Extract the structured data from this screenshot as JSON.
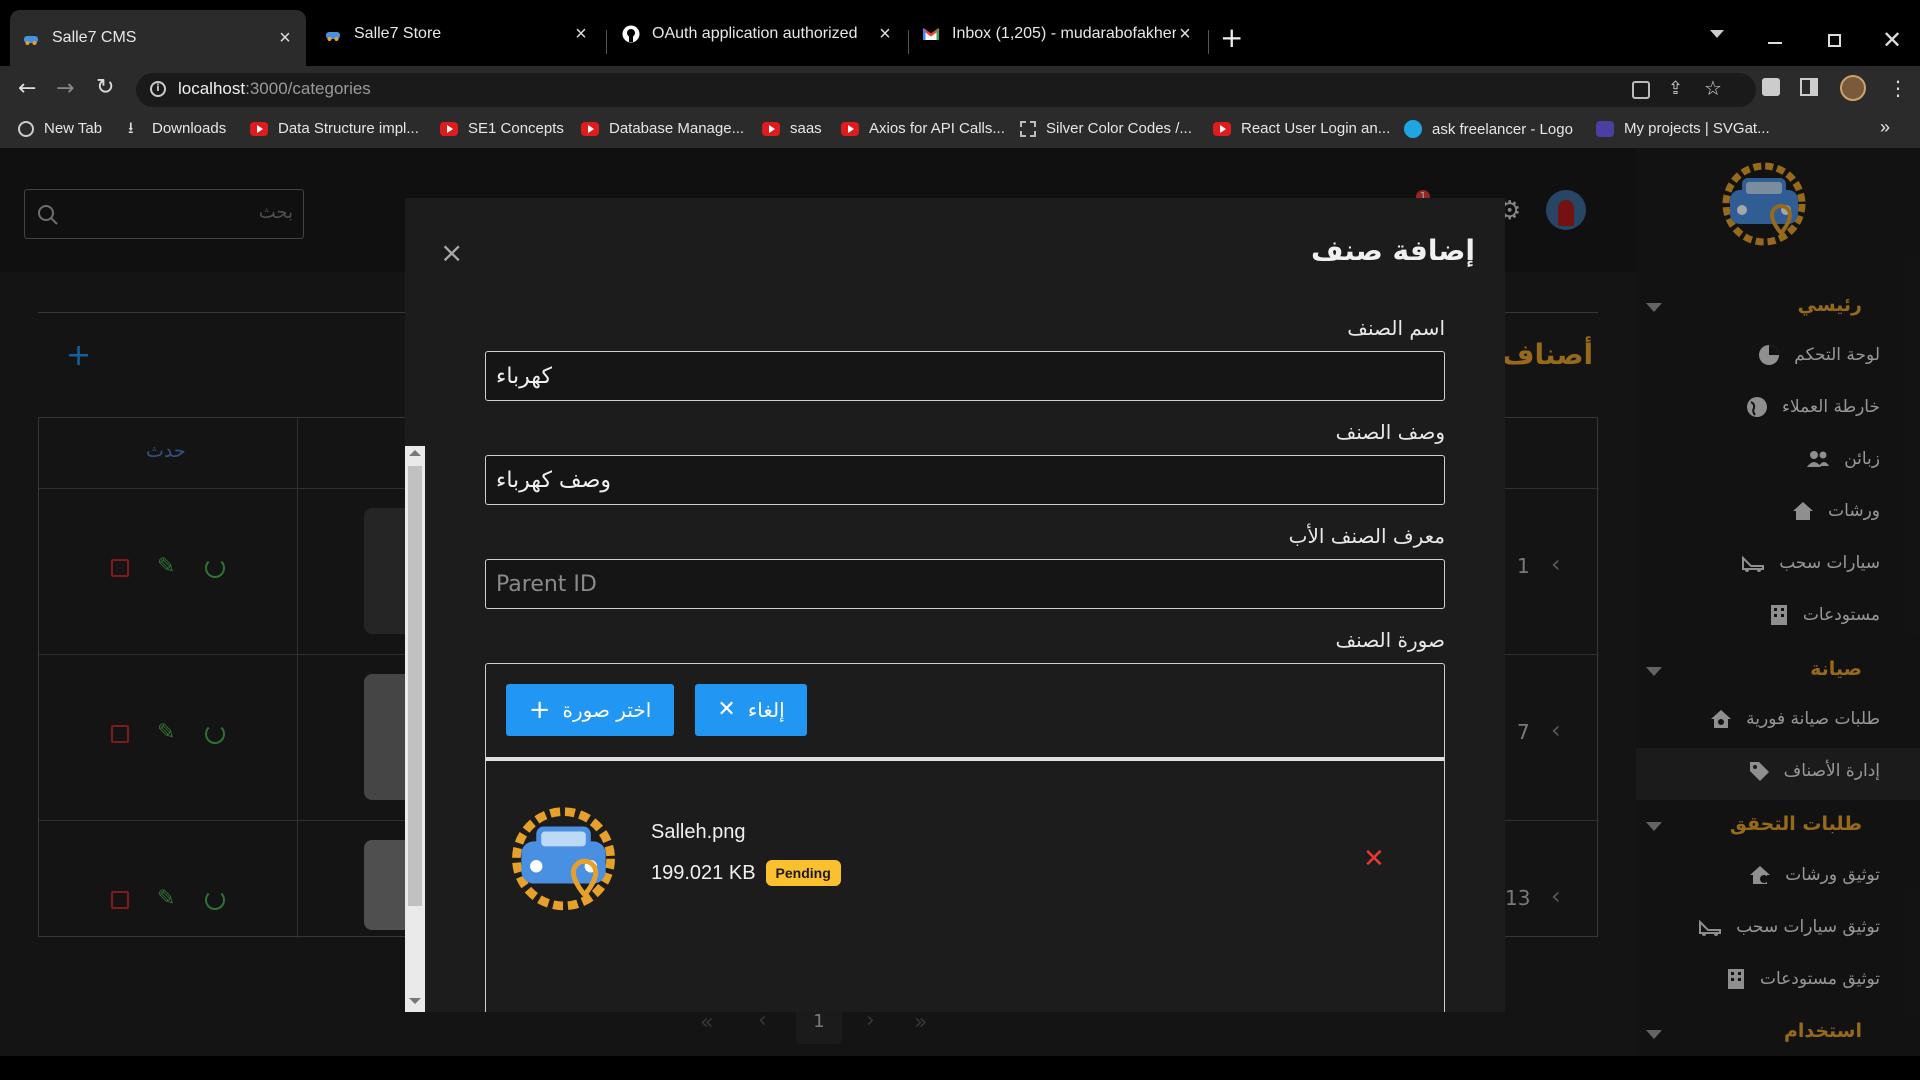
{
  "browser": {
    "tabs": [
      {
        "title": "Salle7 CMS",
        "active": true
      },
      {
        "title": "Salle7 Store",
        "active": false
      },
      {
        "title": "OAuth application authorized",
        "active": false
      },
      {
        "title": "Inbox (1,205) - mudarabofakher@",
        "active": false
      }
    ],
    "url_host": "localhost",
    "url_path": ":3000/categories",
    "bookmarks": [
      {
        "label": "New Tab",
        "icon": "globe-icon"
      },
      {
        "label": "Downloads",
        "icon": "download-icon"
      },
      {
        "label": "Data Structure impl...",
        "icon": "youtube-icon"
      },
      {
        "label": "SE1 Concepts",
        "icon": "youtube-icon"
      },
      {
        "label": "Database Manage...",
        "icon": "youtube-icon"
      },
      {
        "label": "saas",
        "icon": "youtube-icon"
      },
      {
        "label": "Axios for API Calls...",
        "icon": "youtube-icon"
      },
      {
        "label": "Silver Color Codes /...",
        "icon": "grid-icon"
      },
      {
        "label": "React User Login an...",
        "icon": "youtube-icon"
      },
      {
        "label": "ask freelancer - Logo",
        "icon": "canva-icon"
      },
      {
        "label": "My projects | SVGat...",
        "icon": "svgator-icon"
      }
    ],
    "more_bookmarks": "»"
  },
  "header": {
    "search_placeholder": "بحث",
    "notification_count": "1"
  },
  "sidebar": {
    "sections": [
      {
        "title": "رئيسي",
        "items": [
          "لوحة التحكم",
          "خارطة العملاء",
          "زبائن",
          "ورشات",
          "سيارات سحب",
          "مستودعات"
        ]
      },
      {
        "title": "صيانة",
        "items": [
          "طلبات صيانة فورية",
          "إدارة الأصناف"
        ]
      },
      {
        "title": "طلبات التحقق",
        "items": [
          "توثيق ورشات",
          "توثيق سيارات سحب",
          "توثيق مستودعات"
        ]
      },
      {
        "title": "استخدام",
        "items": []
      }
    ],
    "active_item": "إدارة الأصناف"
  },
  "table": {
    "page_title_partial": "أصناف",
    "add_symbol": "+",
    "action_header": "حدث",
    "rows": [
      {
        "count": "1"
      },
      {
        "count": "7"
      },
      {
        "count": "13"
      }
    ],
    "pagination": {
      "first": "«",
      "prev": "‹",
      "current": "1",
      "next": "›",
      "last": "»"
    }
  },
  "modal": {
    "title": "إضافة صنف",
    "close": "×",
    "fields": {
      "name_label": "اسم الصنف",
      "name_value": "كهرباء",
      "desc_label": "وصف الصنف",
      "desc_value": "وصف كهرباء",
      "parent_label": "معرف الصنف الأب",
      "parent_placeholder": "Parent ID",
      "image_label": "صورة الصنف"
    },
    "choose_button": "اختر صورة",
    "cancel_button": "إلغاء",
    "file": {
      "name": "Salleh.png",
      "size": "199.021 KB",
      "status": "Pending"
    },
    "colors": {
      "accent_blue": "#2196f3",
      "pending_yellow": "#fbc02d",
      "remove_red": "#e53935",
      "section_orange": "#e7a12a"
    }
  }
}
